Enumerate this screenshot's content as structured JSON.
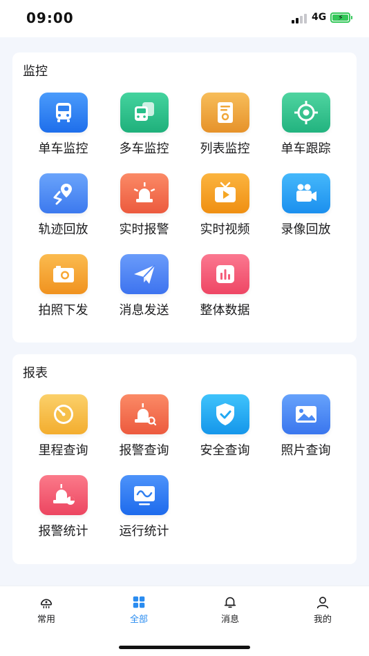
{
  "status_bar": {
    "time": "09:00",
    "network": "4G",
    "battery_icon": "battery-charging-icon"
  },
  "monitor": {
    "title": "监控",
    "items": [
      {
        "label": "单车监控",
        "icon": "bus-icon",
        "color": "#2f80f0"
      },
      {
        "label": "多车监控",
        "icon": "multi-bus-icon",
        "color": "#27c08a"
      },
      {
        "label": "列表监控",
        "icon": "list-monitor-icon",
        "color": "#f0a73a"
      },
      {
        "label": "单车跟踪",
        "icon": "target-icon",
        "color": "#2ec28a"
      },
      {
        "label": "轨迹回放",
        "icon": "track-pin-icon",
        "color": "#4f8df7"
      },
      {
        "label": "实时报警",
        "icon": "alarm-light-icon",
        "color": "#f26b4f"
      },
      {
        "label": "实时视频",
        "icon": "tv-play-icon",
        "color": "#f5a623"
      },
      {
        "label": "录像回放",
        "icon": "video-camera-icon",
        "color": "#2aa3f5"
      },
      {
        "label": "拍照下发",
        "icon": "camera-icon",
        "color": "#f7a734"
      },
      {
        "label": "消息发送",
        "icon": "paper-plane-icon",
        "color": "#4f86f7"
      },
      {
        "label": "整体数据",
        "icon": "bar-chart-icon",
        "color": "#f45b78"
      }
    ]
  },
  "report": {
    "title": "报表",
    "items": [
      {
        "label": "里程查询",
        "icon": "speedometer-icon",
        "color": "#f6c04a"
      },
      {
        "label": "报警查询",
        "icon": "alarm-search-icon",
        "color": "#f26b4f"
      },
      {
        "label": "安全查询",
        "icon": "shield-check-icon",
        "color": "#20a8f2"
      },
      {
        "label": "照片查询",
        "icon": "picture-icon",
        "color": "#4a8af4"
      },
      {
        "label": "报警统计",
        "icon": "alarm-stats-icon",
        "color": "#f25a6e"
      },
      {
        "label": "运行统计",
        "icon": "wave-screen-icon",
        "color": "#2f7ff0"
      }
    ]
  },
  "tabbar": {
    "tabs": [
      {
        "label": "常用",
        "icon": "frequent-icon",
        "active": false
      },
      {
        "label": "全部",
        "icon": "grid-icon",
        "active": true
      },
      {
        "label": "消息",
        "icon": "bell-icon",
        "active": false
      },
      {
        "label": "我的",
        "icon": "user-icon",
        "active": false
      }
    ],
    "active_color": "#2a8cf0"
  }
}
